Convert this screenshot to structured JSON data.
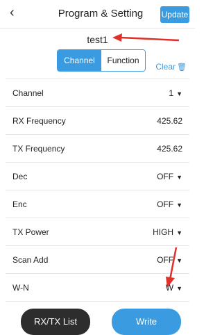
{
  "header": {
    "back_icon": "chevron-left-icon",
    "title": "Program & Setting",
    "update_label": "Update"
  },
  "program_name": "test1",
  "tabs": [
    {
      "label": "Channel",
      "active": true
    },
    {
      "label": "Function",
      "active": false
    }
  ],
  "clear_label": "Clear",
  "settings": [
    {
      "label": "Channel",
      "value": "1",
      "dropdown": true
    },
    {
      "label": "RX Frequency",
      "value": "425.62",
      "dropdown": false
    },
    {
      "label": "TX Frequency",
      "value": "425.62",
      "dropdown": false
    },
    {
      "label": "Dec",
      "value": "OFF",
      "dropdown": true
    },
    {
      "label": "Enc",
      "value": "OFF",
      "dropdown": true
    },
    {
      "label": "TX Power",
      "value": "HIGH",
      "dropdown": true
    },
    {
      "label": "Scan Add",
      "value": "OFF",
      "dropdown": true
    },
    {
      "label": "W-N",
      "value": "W",
      "dropdown": true
    }
  ],
  "buttons": {
    "rxtx_label": "RX/TX List",
    "write_label": "Write"
  },
  "colors": {
    "accent": "#3a9be0",
    "dark_button": "#2d2d2d",
    "annotation_arrow": "#e0302a"
  }
}
